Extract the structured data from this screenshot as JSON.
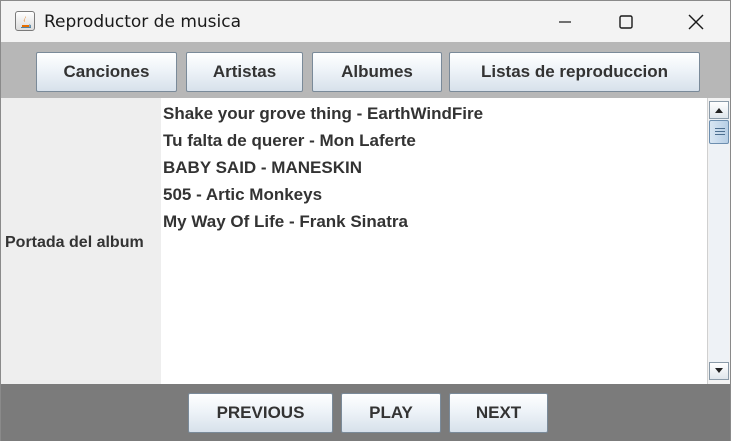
{
  "window": {
    "title": "Reproductor de musica"
  },
  "tabs": [
    {
      "label": "Canciones"
    },
    {
      "label": "Artistas"
    },
    {
      "label": "Albumes"
    },
    {
      "label": "Listas de reproduccion"
    }
  ],
  "left_panel": {
    "cover_label": "Portada del album"
  },
  "songs": [
    "Shake your grove thing - EarthWindFire",
    "Tu falta de querer - Mon Laferte",
    "BABY SAID - MANESKIN",
    "505 - Artic Monkeys",
    "My Way Of Life - Frank Sinatra"
  ],
  "controls": {
    "previous_label": "PREVIOUS",
    "play_label": "PLAY",
    "next_label": "NEXT"
  },
  "icons": {
    "app": "java-app-icon",
    "minimize": "minimize-icon",
    "maximize": "maximize-icon",
    "close": "close-icon",
    "scroll_up": "arrow-up-icon",
    "scroll_down": "arrow-down-icon"
  },
  "colors": {
    "topbar_bg": "#b7b7b7",
    "bottombar_bg": "#7b7b7b",
    "left_panel_bg": "#eeeeee",
    "text": "#333333"
  }
}
